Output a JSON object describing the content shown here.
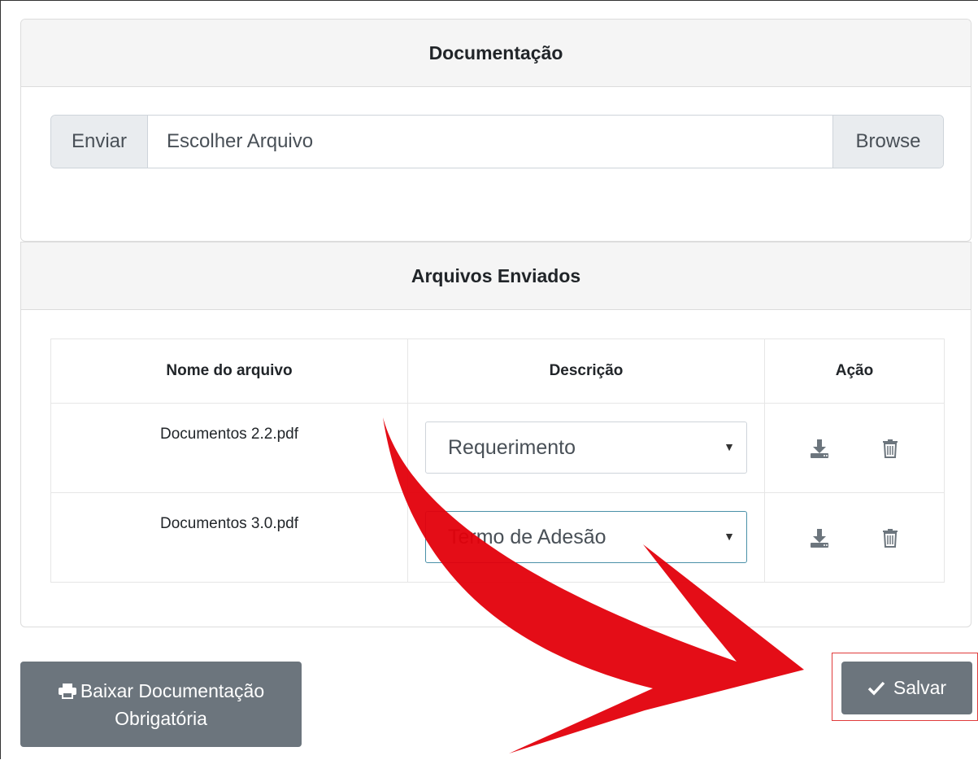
{
  "doc_section": {
    "title": "Documentação",
    "upload": {
      "prepend": "Enviar",
      "placeholder": "Escolher Arquivo",
      "browse": "Browse"
    }
  },
  "files_section": {
    "title": "Arquivos Enviados",
    "columns": [
      "Nome do arquivo",
      "Descrição",
      "Ação"
    ],
    "rows": [
      {
        "name": "Documentos 2.2.pdf",
        "description": "Requerimento"
      },
      {
        "name": "Documentos 3.0.pdf",
        "description": "Termo de Adesão"
      }
    ],
    "action_icons": [
      "download-icon",
      "trash-icon"
    ]
  },
  "buttons": {
    "baixar_line1": "Baixar Documentação",
    "baixar_line2": "Obrigatória",
    "salvar": "Salvar"
  },
  "colors": {
    "button_gray": "#6c757d",
    "annotation_red": "#e3000b",
    "header_bg": "#f5f5f5"
  }
}
